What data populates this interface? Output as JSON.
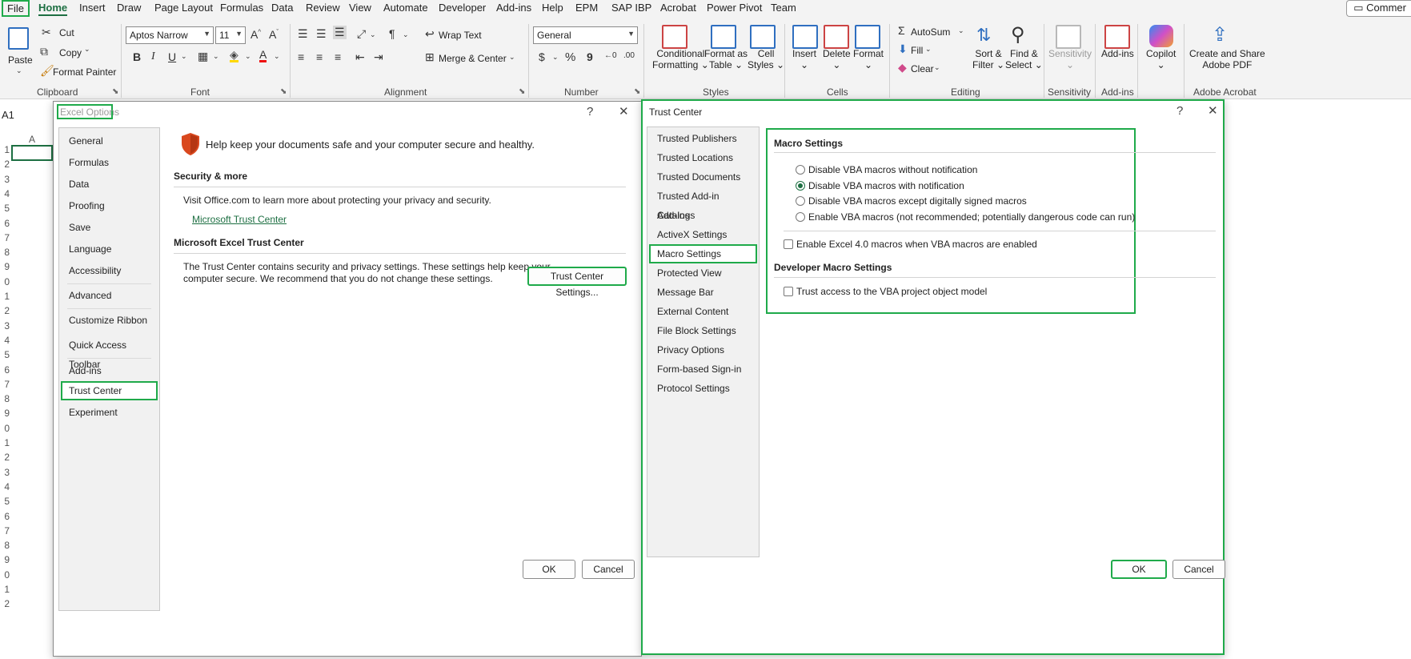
{
  "ribbon_tabs": [
    "File",
    "Home",
    "Insert",
    "Draw",
    "Page Layout",
    "Formulas",
    "Data",
    "Review",
    "View",
    "Automate",
    "Developer",
    "Add-ins",
    "Help",
    "EPM",
    "SAP IBP",
    "Acrobat",
    "Power Pivot",
    "Team"
  ],
  "comments_label": "Commer",
  "clipboard": {
    "paste": "Paste",
    "cut": "Cut",
    "copy": "Copy",
    "format_painter": "Format Painter",
    "group": "Clipboard"
  },
  "font": {
    "name": "Aptos Narrow",
    "size": "11",
    "bold": "B",
    "italic": "I",
    "underline": "U",
    "group": "Font"
  },
  "alignment": {
    "wrap": "Wrap Text",
    "merge": "Merge & Center",
    "group": "Alignment"
  },
  "number": {
    "format": "General",
    "currency": "$",
    "percent": "%",
    "comma": "9",
    "group": "Number"
  },
  "styles": {
    "conditional": "Conditional",
    "conditional2": "Formatting",
    "format_as": "Format as",
    "format_as2": "Table",
    "cell": "Cell",
    "cell2": "Styles",
    "group": "Styles"
  },
  "cells": {
    "insert": "Insert",
    "delete": "Delete",
    "format": "Format",
    "group": "Cells"
  },
  "editing": {
    "autosum": "AutoSum",
    "fill": "Fill",
    "clear": "Clear",
    "sort": "Sort &",
    "sort2": "Filter",
    "find": "Find &",
    "find2": "Select",
    "group": "Editing"
  },
  "sensitivity": {
    "label": "Sensitivity",
    "group": "Sensitivity"
  },
  "addins": {
    "label": "Add-ins",
    "group": "Add-ins"
  },
  "copilot": {
    "label": "Copilot"
  },
  "acrobat": {
    "label1": "Create and Share",
    "label2": "Adobe PDF",
    "group": "Adobe Acrobat"
  },
  "namebox": "A1",
  "sheet": {
    "col_a": "A",
    "rows": [
      "1",
      "2",
      "3",
      "4",
      "5",
      "6",
      "7",
      "8",
      "9",
      "0",
      "1",
      "2",
      "3",
      "4",
      "5",
      "6",
      "7",
      "8",
      "9",
      "0",
      "1",
      "2",
      "3",
      "4",
      "5",
      "6",
      "7",
      "8",
      "9",
      "0",
      "1",
      "2"
    ]
  },
  "excel_options": {
    "title": "Excel Options",
    "help": "?",
    "close": "✕",
    "nav": [
      "General",
      "Formulas",
      "Data",
      "Proofing",
      "Save",
      "Language",
      "Accessibility",
      "Advanced",
      "Customize Ribbon",
      "Quick Access Toolbar",
      "Add-ins",
      "Trust Center",
      "Experiment"
    ],
    "selected": "Trust Center",
    "banner": "Help keep your documents safe and your computer secure and healthy.",
    "security_title": "Security & more",
    "security_text": "Visit Office.com to learn more about protecting your privacy and security.",
    "trust_link": "Microsoft Trust Center",
    "tc_title": "Microsoft Excel Trust Center",
    "tc_text1": "The Trust Center contains security and privacy settings. These settings help keep your",
    "tc_text2": "computer secure. We recommend that you do not change these settings.",
    "tc_button": "Trust Center Settings...",
    "ok": "OK",
    "cancel": "Cancel"
  },
  "trust_center": {
    "title": "Trust Center",
    "help": "?",
    "close": "✕",
    "nav": [
      "Trusted Publishers",
      "Trusted Locations",
      "Trusted Documents",
      "Trusted Add-in Catalogs",
      "Add-ins",
      "ActiveX Settings",
      "Macro Settings",
      "Protected View",
      "Message Bar",
      "External Content",
      "File Block Settings",
      "Privacy Options",
      "Form-based Sign-in",
      "Protocol Settings"
    ],
    "selected": "Macro Settings",
    "macro_title": "Macro Settings",
    "radios": [
      {
        "label": "Disable VBA macros without notification",
        "checked": false
      },
      {
        "label": "Disable VBA macros with notification",
        "checked": true
      },
      {
        "label": "Disable VBA macros except digitally signed macros",
        "checked": false
      },
      {
        "label": "Enable VBA macros (not recommended; potentially dangerous code can run)",
        "checked": false
      }
    ],
    "excel4": "Enable Excel 4.0 macros when VBA macros are enabled",
    "dev_title": "Developer Macro Settings",
    "vba_access": "Trust access to the VBA project object model",
    "ok": "OK",
    "cancel": "Cancel"
  },
  "colors": {
    "accent": "#1d6f42",
    "highlight": "#1faa4a",
    "shield": "#d9481e"
  }
}
